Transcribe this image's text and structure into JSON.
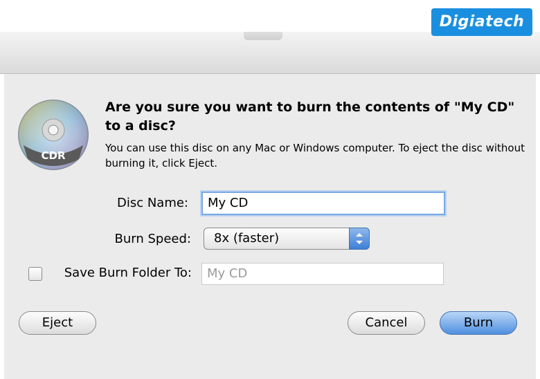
{
  "watermark": {
    "text": "Digiatech"
  },
  "dialog": {
    "icon": {
      "name": "cd-disc-icon",
      "label": "CDR"
    },
    "title": "Are you sure you want to burn the contents of \"My CD\" to a disc?",
    "message": "You can use this disc on any Mac or Windows computer. To eject the disc without burning it, click Eject.",
    "disc_name": {
      "label": "Disc Name:",
      "value": "My CD"
    },
    "burn_speed": {
      "label": "Burn Speed:",
      "selected": "8x (faster)"
    },
    "save_folder": {
      "label": "Save Burn Folder To:",
      "checked": false,
      "placeholder": "My CD"
    },
    "buttons": {
      "eject": "Eject",
      "cancel": "Cancel",
      "burn": "Burn"
    }
  },
  "colors": {
    "accent": "#4f8fe0",
    "watermark_bg": "#1a8fe0"
  }
}
